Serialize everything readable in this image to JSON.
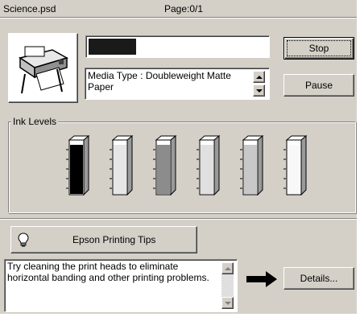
{
  "header": {
    "filename": "Science.psd",
    "page_status": "Page:0/1"
  },
  "progress": {
    "fraction": 0.27
  },
  "media": {
    "text": "Media Type : Doubleweight Matte Paper"
  },
  "buttons": {
    "stop_label": "Stop",
    "pause_label": "Pause",
    "tips_label": "Epson Printing Tips",
    "details_label": "Details..."
  },
  "ink": {
    "group_label": "Ink Levels",
    "cartridges": [
      {
        "color": "#000000",
        "level": 1.0
      },
      {
        "color": "#e6e6e6",
        "level": 1.0
      },
      {
        "color": "#8c8c8c",
        "level": 1.0
      },
      {
        "color": "#e0e0e0",
        "level": 1.0
      },
      {
        "color": "#c8c8c8",
        "level": 1.0
      },
      {
        "color": "#f8f8f8",
        "level": 1.0
      }
    ]
  },
  "tips": {
    "message": "Try cleaning the print heads to eliminate horizontal banding and other printing problems."
  },
  "icons": {
    "printer": "printer-icon",
    "bulb": "lightbulb-icon",
    "arrow": "right-arrow-icon"
  }
}
